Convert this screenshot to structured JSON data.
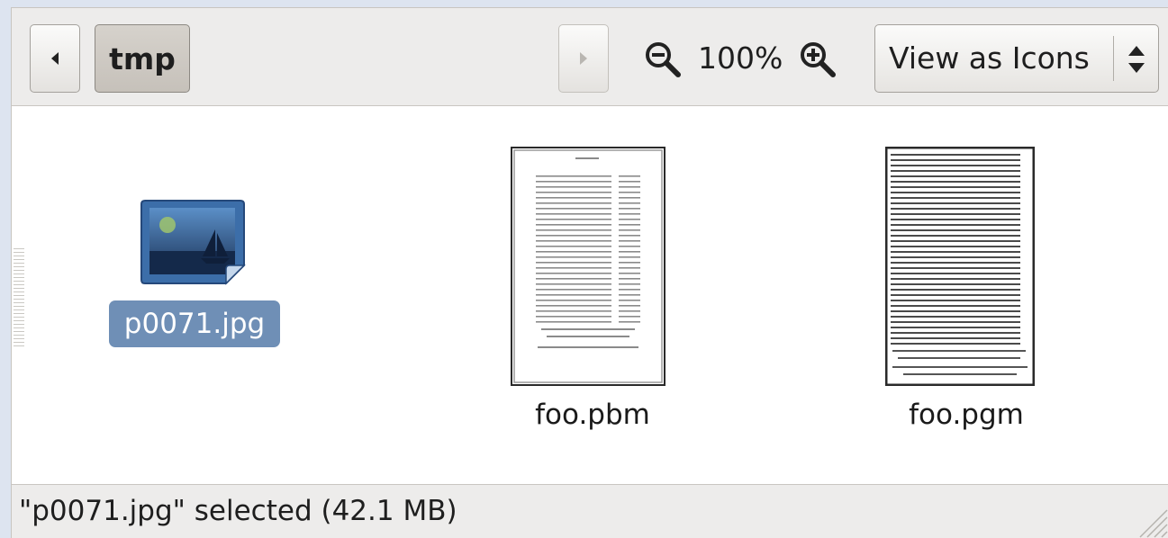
{
  "toolbar": {
    "back_icon": "left-arrow-icon",
    "path_button": "tmp",
    "forward_icon": "right-arrow-icon",
    "zoom_out_icon": "zoom-out-icon",
    "zoom_level": "100%",
    "zoom_in_icon": "zoom-in-icon",
    "view_mode": "View as Icons",
    "view_mode_icon": "up-down-arrows-icon"
  },
  "files": [
    {
      "name": "p0071.jpg",
      "icon": "image-file-icon",
      "selected": true
    },
    {
      "name": "foo.pbm",
      "icon": "text-page-thumbnail",
      "selected": false
    },
    {
      "name": "foo.pgm",
      "icon": "text-page-thumbnail",
      "selected": false
    }
  ],
  "statusbar": {
    "text": "\"p0071.jpg\" selected (42.1 MB)"
  },
  "colors": {
    "selection": "#6f8fb6",
    "toolbar_bg": "#edeceb",
    "content_bg": "#ffffff"
  }
}
